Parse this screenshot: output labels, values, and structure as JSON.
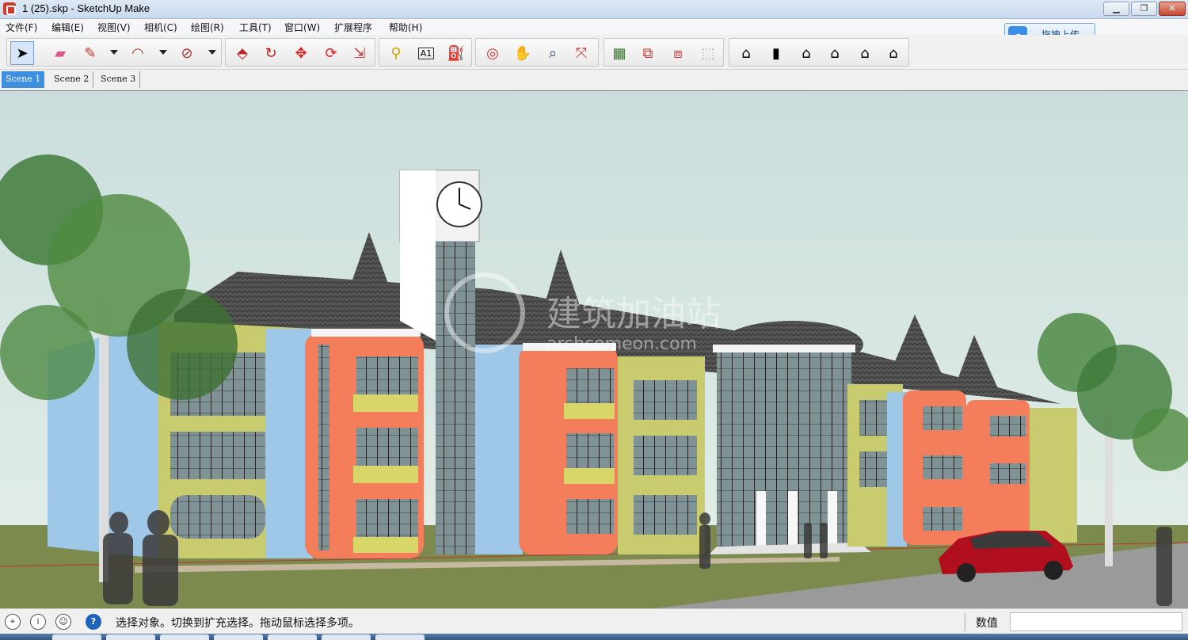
{
  "window": {
    "title": "1 (25).skp - SketchUp Make",
    "min_icon": "minimize-icon",
    "max_icon": "restore-icon",
    "close_icon": "close-icon"
  },
  "menu": [
    "文件(F)",
    "编辑(E)",
    "视图(V)",
    "相机(C)",
    "绘图(R)",
    "工具(T)",
    "窗口(W)",
    "扩展程序",
    "帮助(H)"
  ],
  "upload": {
    "label": "拖拽上传",
    "icon": "cloud-upload-icon"
  },
  "toolbar": {
    "tools": [
      "select-icon",
      "eraser-icon",
      "pencil-icon",
      "arc-icon",
      "shape-icon",
      "push-pull-icon",
      "follow-me-icon",
      "move-icon",
      "rotate-icon",
      "scale-icon",
      "tape-measure-icon",
      "text-icon",
      "paint-bucket-icon",
      "orbit-icon",
      "pan-icon",
      "zoom-icon",
      "zoom-extents-icon",
      "add-location-icon",
      "get-models-icon",
      "share-model-icon",
      "extension-warehouse-icon",
      "iso-view-icon",
      "front-view-icon",
      "top-view-icon",
      "right-view-icon",
      "back-view-icon",
      "left-view-icon"
    ]
  },
  "scenes": [
    "Scene 1",
    "Scene 2",
    "Scene 3"
  ],
  "active_scene": "Scene 1",
  "watermark": {
    "brand": "建筑加油站",
    "url": "archcomeon.com"
  },
  "status": {
    "message": "选择对象。切换到扩充选择。拖动鼠标选择多项。",
    "value_label": "数值",
    "value": ""
  },
  "colors": {
    "sky": "#cfe0e0",
    "grass": "#7c8a4e",
    "orange_tower": "#f47d5c",
    "yellow_wall": "#c9cc6e",
    "blue_wall": "#9fc7e8",
    "roof": "#4a4a4a",
    "car": "#b10f1e",
    "active_tab": "#3f8fe0"
  }
}
